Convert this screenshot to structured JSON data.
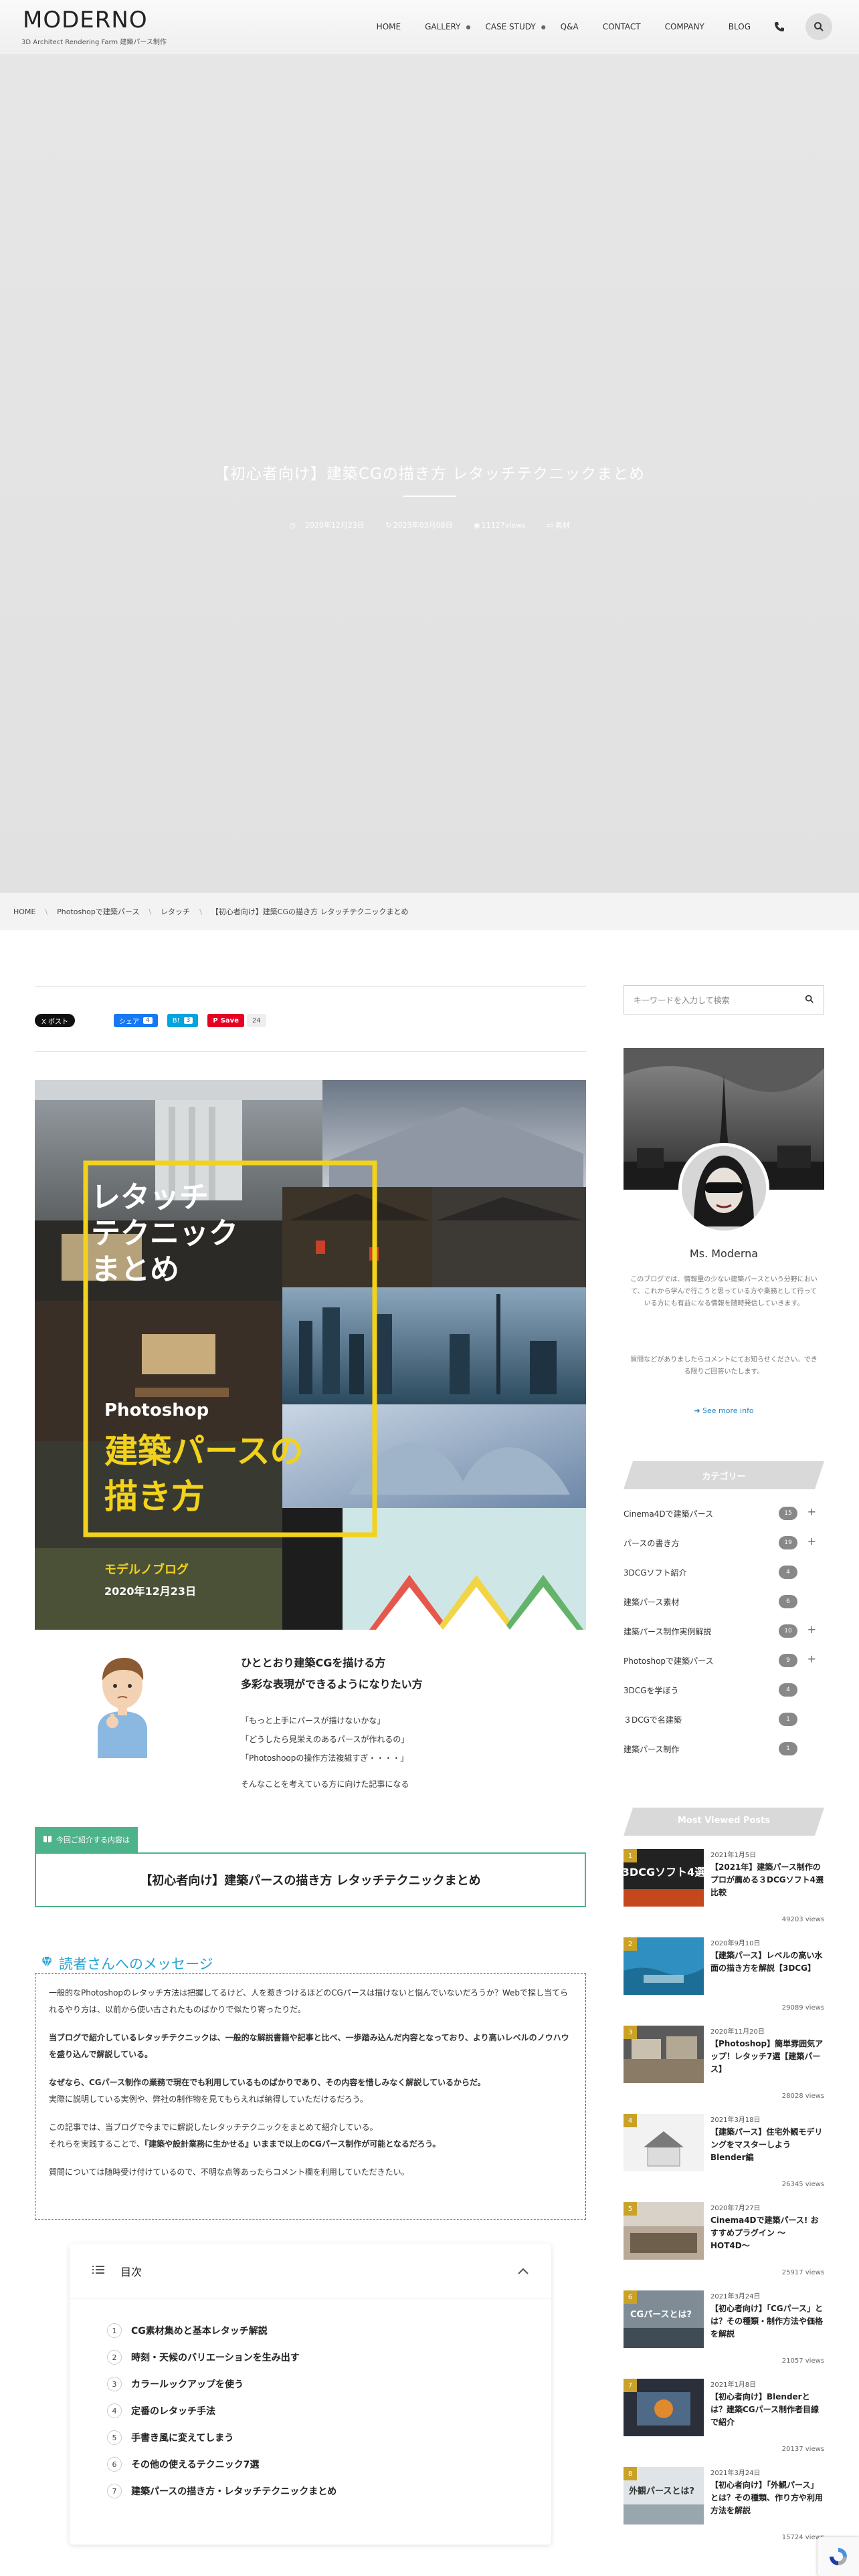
{
  "header": {
    "logo": "MODERNO",
    "tagline": "3D Architect Rendering Farm 建築パース制作",
    "nav": [
      {
        "label": "HOME",
        "dropdown": false
      },
      {
        "label": "GALLERY",
        "dropdown": true
      },
      {
        "label": "CASE STUDY",
        "dropdown": true
      },
      {
        "label": "Q&A",
        "dropdown": false
      },
      {
        "label": "CONTACT",
        "dropdown": false
      },
      {
        "label": "COMPANY",
        "dropdown": false
      },
      {
        "label": "BLOG",
        "dropdown": false
      }
    ],
    "phone_icon": "phone-icon",
    "search_icon": "search-icon"
  },
  "hero": {
    "title": "【初心者向け】建築CGの描き方 レタッチテクニックまとめ",
    "published": "2020年12月23日",
    "updated": "2023年03月08日",
    "views": "11127views",
    "category": "素材"
  },
  "breadcrumb": [
    "HOME",
    "Photoshopで建築パース",
    "レタッチ",
    "【初心者向け】建築CGの描き方 レタッチテクニックまとめ"
  ],
  "share": {
    "x_label": "X ポスト",
    "fb_label": "シェア",
    "fb_count": "4",
    "hb_label": "B!",
    "hb_count": "3",
    "pin_label": "Save",
    "pin_count": "24"
  },
  "eyecatch": {
    "line1": "レタッチ",
    "line2": "テクニック",
    "line3": "まとめ",
    "badge": "Photoshop",
    "big1": "建築パースの",
    "big2": "描き方",
    "brand": "モデルノブログ",
    "date": "2020年12月23日"
  },
  "intro": {
    "lead1": "ひととおり建築CGを描ける方",
    "lead2": "多彩な表現ができるようになりたい方",
    "q1": "「もっと上手にパースが描けないかな」",
    "q2": "「どうしたら見栄えのあるパースが作れるの」",
    "q3": "「Photoshoopの操作方法複雑すぎ・・・・」",
    "tail": "そんなことを考えている方に向けた記事になる"
  },
  "intro_box": {
    "tag": "今回ご紹介する内容は",
    "title": "【初心者向け】建築パースの描き方 レタッチテクニックまとめ"
  },
  "message": {
    "title": "読者さんへのメッセージ",
    "p1": "一般的なPhotoshopのレタッチ方法は把握してるけど、人を惹きつけるほどのCGパースは描けないと悩んでいないだろうか？Webで探し当てられるやり方は、以前から使い古されたものばかりで似たり寄ったりだ。",
    "p2": "当ブログで紹介しているレタッチテクニックは、一般的な解説書籍や記事と比べ、一歩踏み込んだ内容となっており、より高いレベルのノウハウを盛り込んで解説している。",
    "p3a": "なぜなら、CGパース制作の業務で現在でも利用しているものばかりであり、その内容を惜しみなく解説しているからだ。",
    "p3b": "実際に説明している実例や、弊社の制作物を見てもらえれば納得していただけるだろう。",
    "p4a": "この記事では、当ブログで今までに解説したレタッチテクニックをまとめて紹介している。",
    "p4b_pre": "それらを実践することで、",
    "p4b_bold": "『建築や設計業務に生かせる』いままで以上のCGパース制作が可能となるだろう。",
    "p5": "質問については随時受け付けているので、不明な点等あったらコメント欄を利用していただきたい。"
  },
  "toc": {
    "title": "目次",
    "items": [
      {
        "num": "1",
        "text": "CG素材集めと基本レタッチ解説"
      },
      {
        "num": "2",
        "text": "時刻・天候のバリエーションを生み出す"
      },
      {
        "num": "3",
        "text": "カラールックアップを使う"
      },
      {
        "num": "4",
        "text": "定番のレタッチ手法"
      },
      {
        "num": "5",
        "text": "手書き風に変えてしまう"
      },
      {
        "num": "6",
        "text": "その他の使えるテクニック7選"
      },
      {
        "num": "7",
        "text": "建築パースの描き方・レタッチテクニックまとめ"
      }
    ]
  },
  "sidebar": {
    "search_placeholder": "キーワードを入力して検索",
    "profile_name": "Ms. Moderna",
    "bio": "このブログでは、情報量の少ない建築パースという分野において、これから学んで行こうと思っている方や業務として行っている方にも有益になる情報を随時発信していきます。",
    "note": "質問などがありましたらコメントにてお知らせください。できる限りご回答いたします。",
    "see_more": "See more info",
    "categories_head": "カテゴリー",
    "categories": [
      {
        "label": "Cinema4Dで建築パース",
        "count": "15",
        "plus": true
      },
      {
        "label": "パースの書き方",
        "count": "19",
        "plus": true
      },
      {
        "label": "3DCGソフト紹介",
        "count": "4",
        "plus": false
      },
      {
        "label": "建築パース素材",
        "count": "6",
        "plus": false
      },
      {
        "label": "建築パース制作実例解説",
        "count": "10",
        "plus": true
      },
      {
        "label": "Photoshopで建築パース",
        "count": "9",
        "plus": true
      },
      {
        "label": "3DCGを学ぼう",
        "count": "4",
        "plus": false
      },
      {
        "label": "３DCGで名建築",
        "count": "1",
        "plus": false
      },
      {
        "label": "建築パース制作",
        "count": "1",
        "plus": false
      }
    ],
    "popular_head": "Most Viewed Posts",
    "popular": [
      {
        "rank": "1",
        "date": "2021年1月5日",
        "title": "【2021年】建築パース制作のプロが薦める３DCGソフト4選比較",
        "views": "49203 views",
        "thumb": "3DCGソフト4選"
      },
      {
        "rank": "2",
        "date": "2020年9月10日",
        "title": "【建築パース】レベルの高い水面の描き方を解説【3DCG】",
        "views": "29089 views",
        "thumb": ""
      },
      {
        "rank": "3",
        "date": "2020年11月20日",
        "title": "【Photoshop】簡単雰囲気アップ！レタッチ7選【建築パース】",
        "views": "28028 views",
        "thumb": ""
      },
      {
        "rank": "4",
        "date": "2021年3月18日",
        "title": "【建築パース】住宅外観モデリングをマスターしようBlender編",
        "views": "26345 views",
        "thumb": ""
      },
      {
        "rank": "5",
        "date": "2020年7月27日",
        "title": "Cinema4Dで建築パース! おすすめプラグイン 〜HOT4D〜",
        "views": "25917 views",
        "thumb": ""
      },
      {
        "rank": "6",
        "date": "2021年3月24日",
        "title": "【初心者向け】「CGパース」とは？その種類・制作方法や価格を解説",
        "views": "21057 views",
        "thumb": "CGパースとは?"
      },
      {
        "rank": "7",
        "date": "2021年1月8日",
        "title": "【初心者向け】Blenderとは？建築CGパース制作者目線で紹介",
        "views": "20137 views",
        "thumb": ""
      },
      {
        "rank": "8",
        "date": "2021年3月24日",
        "title": "【初心者向け】「外観パース」とは？その種類、作り方や利用方法を解説",
        "views": "15724 views",
        "thumb": "外観パースとは?"
      }
    ]
  },
  "colors": {
    "accent_green": "#4db38a",
    "accent_blue": "#29a3d4",
    "eyecatch_yellow": "#f2d21b",
    "rank_gold": "#c9a227"
  }
}
